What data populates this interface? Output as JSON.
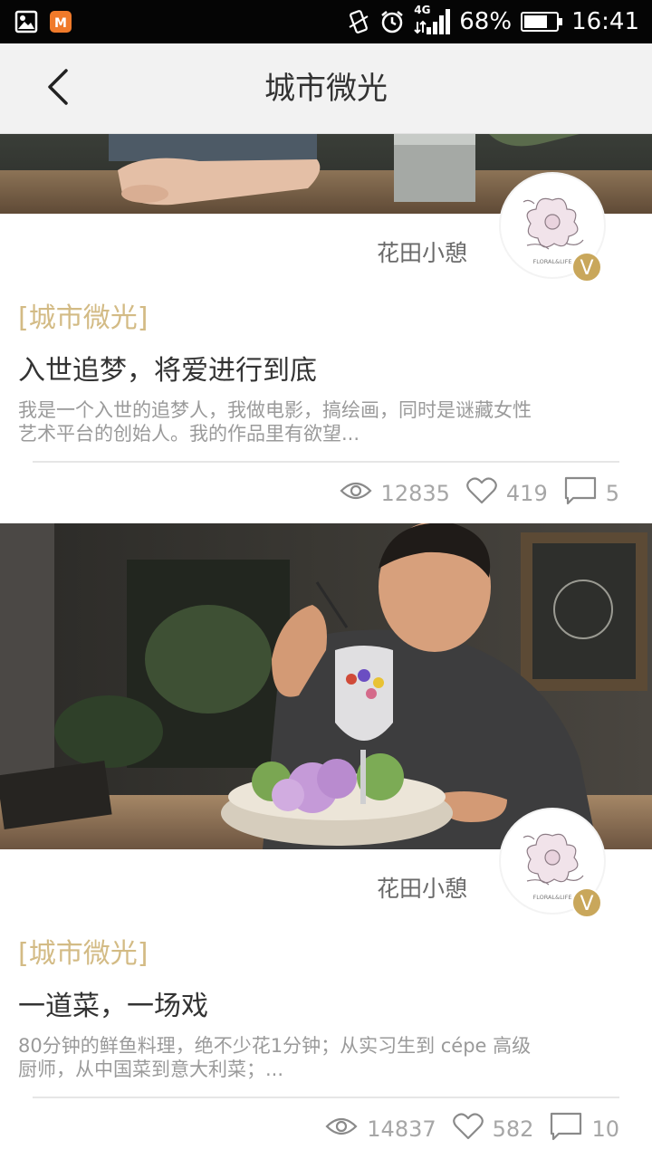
{
  "status_bar": {
    "battery": "68%",
    "time": "16:41",
    "network": "4G",
    "icons": [
      "gallery-icon",
      "app-icon",
      "vibrate-icon",
      "alarm-icon",
      "signal-icon",
      "battery-icon"
    ]
  },
  "header": {
    "title": "城市微光",
    "back_icon": "chevron-left-icon"
  },
  "articles": [
    {
      "author": "花田小憩",
      "category": "[城市微光]",
      "title": "入世追梦，将爱进行到底",
      "summary_line1": "我是一个入世的追梦人，我做电影，搞绘画，同时是谜藏女性",
      "summary_line2": "艺术平台的创始人。我的作品里有欲望...",
      "views": "12835",
      "likes": "419",
      "comments": "5"
    },
    {
      "author": "花田小憩",
      "category": "[城市微光]",
      "title": "一道菜，一场戏",
      "summary_line1": "80分钟的鲜鱼料理，绝不少花1分钟；从实习生到 cépe 高级",
      "summary_line2": "厨师，从中国菜到意大利菜；...",
      "views": "14837",
      "likes": "582",
      "comments": "10"
    }
  ],
  "avatar_logo_text": "FLORAL&LIFE",
  "verified_mark": "V",
  "colors": {
    "accent": "#c9a75b",
    "category": "#d3bb85",
    "header_bg": "#f2f2f2",
    "status_bar_bg": "#050505"
  }
}
